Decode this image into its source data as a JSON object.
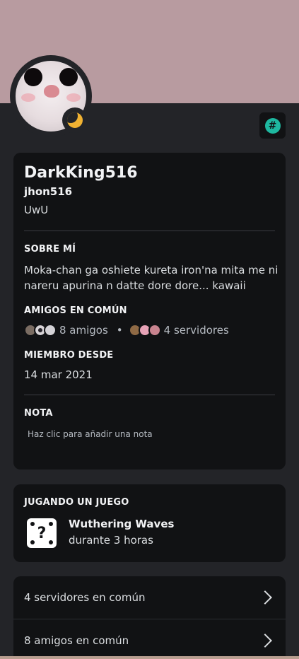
{
  "profile": {
    "display_name": "DarkKing516",
    "username": "jhon516",
    "pronouns": "UwU",
    "status": "idle",
    "banner_color": "#b89ba0"
  },
  "about": {
    "title": "SOBRE MÍ",
    "text": "Moka-chan ga oshiete kureta iron'na mita me ni nareru apurina n datte dore dore... kawaii"
  },
  "mutual": {
    "title": "AMIGOS EN COMÚN",
    "friends_label": "8 amigos",
    "separator": "•",
    "servers_label": "4 servidores"
  },
  "member_since": {
    "title": "MIEMBRO DESDE",
    "date": "14 mar 2021"
  },
  "note": {
    "title": "NOTA",
    "placeholder": "Haz clic para añadir una nota"
  },
  "activity": {
    "title": "JUGANDO UN JUEGO",
    "game": "Wuthering Waves",
    "duration": "durante 3 horas"
  },
  "list": {
    "servers": "4 servidores en común",
    "friends": "8 amigos en común"
  },
  "icons": {
    "status": "moon-icon",
    "badge": "hashtag-icon",
    "game": "dice-icon",
    "chevron": "chevron-right-icon"
  }
}
